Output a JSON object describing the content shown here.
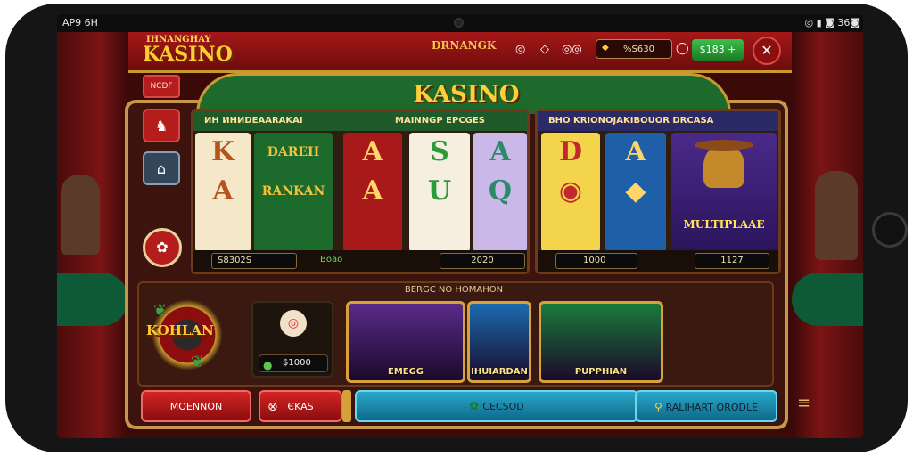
{
  "status": {
    "left": "AP9 6H",
    "right": "◎ ▮ ◙ 36◙"
  },
  "topbar": {
    "brand_small": "IHNANGHAY",
    "brand": "KASINO",
    "brand_center": "DRNANGK",
    "icons": [
      "◎",
      "◇",
      "◎◎"
    ],
    "coin_value": "%S630",
    "deposit_label": "$183 +",
    "tools_icon": "tools-icon"
  },
  "title": "KASINO",
  "sidebar": {
    "menu_label": "NCDF"
  },
  "panel1": {
    "head_left": "ИН ИНИDЕАARAKAI",
    "head_right": "MAINNGP EPCGES",
    "reels": [
      {
        "symbols": [
          "K",
          "A"
        ],
        "bg": "#f5e8c8",
        "color": "#b5541c"
      },
      {
        "symbols": [
          "DAREH",
          "RANKAN"
        ],
        "bg": "#1c6a2c",
        "color": "#f3c23a"
      },
      {
        "symbols": [
          "A",
          "A"
        ],
        "bg": "#a81a1a",
        "color": "#ffd56a"
      },
      {
        "symbols": [
          "S",
          "U"
        ],
        "bg": "#f6efe0",
        "color": "#2a9a3a"
      },
      {
        "symbols": [
          "A",
          "Q"
        ],
        "bg": "#cbb8e8",
        "color": "#2a8a6a"
      }
    ],
    "foot_left": "S8302S",
    "foot_mid": "Boao",
    "foot_right": "2020"
  },
  "panel2": {
    "head": "BHO KRIONOJAKIBOUOR DRCASA",
    "reels": [
      {
        "symbols": [
          "D",
          "◉"
        ],
        "bg": "#f3d44a",
        "color": "#c2292f"
      },
      {
        "symbols": [
          "A",
          "◆"
        ],
        "bg": "#1e5fa8",
        "color": "#ffd56a"
      }
    ],
    "character_label": "MULTIPLAAE",
    "foot_left": "1000",
    "foot_right": "1127"
  },
  "promo": {
    "roulette_label": "KOHLAN",
    "mini_amount": "$1000",
    "section_label": "BERGC NO HOMAHON",
    "thumbs": [
      {
        "label": "EMEGG",
        "bg": "#5a2a8a"
      },
      {
        "label": "IHUIARDAN",
        "bg": "#1a6ab0"
      },
      {
        "label": "PUPPHIAN",
        "bg": "#1a7a3a"
      }
    ]
  },
  "buttons": {
    "b1": "MOENNON",
    "b2": "ЄKAS",
    "b3": "CECSOD",
    "b4": "RALIHART ORODLE"
  }
}
